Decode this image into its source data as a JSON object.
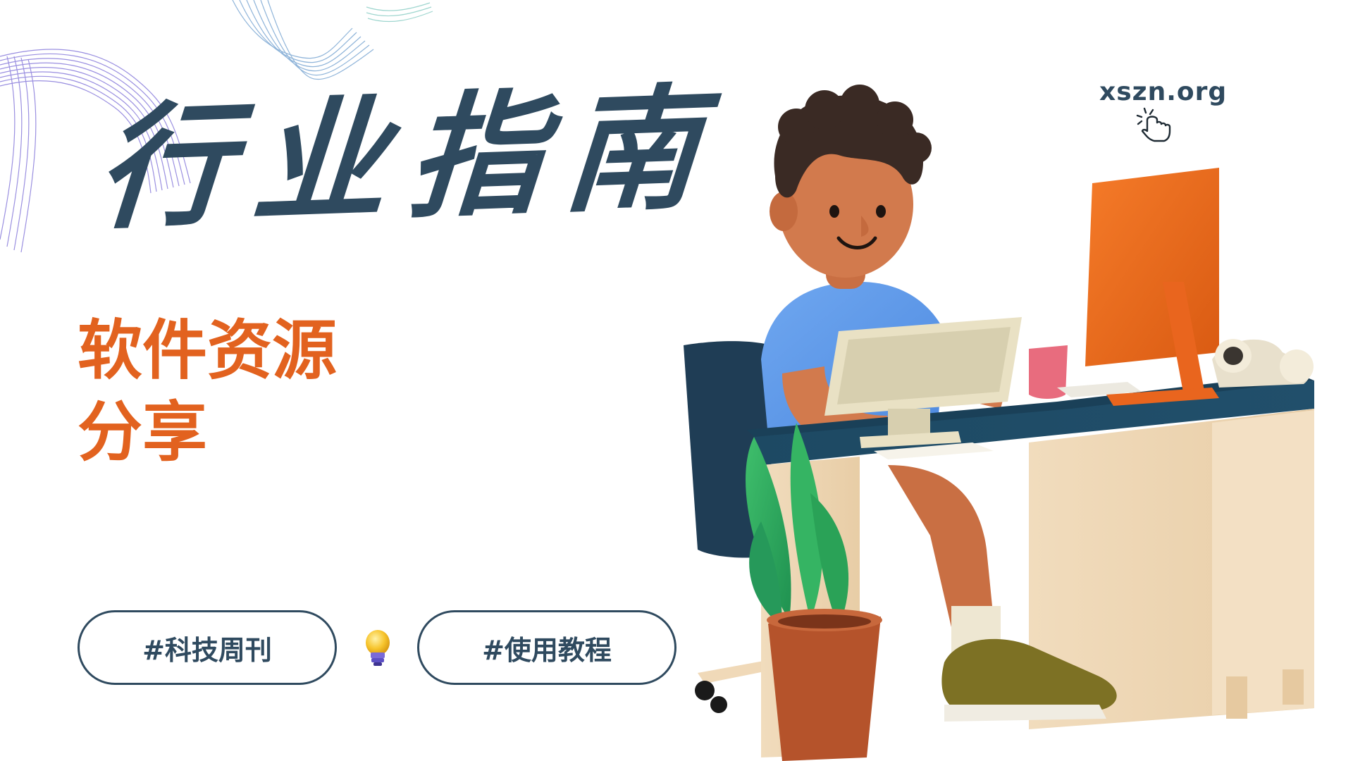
{
  "title": "行业指南",
  "subtitle": {
    "line1": "软件资源",
    "line2": "分享"
  },
  "tags": [
    {
      "label": "#科技周刊"
    },
    {
      "label": "#使用教程"
    }
  ],
  "site": {
    "url": "xszn.org"
  },
  "icons": {
    "bulb": "lightbulb-icon",
    "cursor": "hand-cursor-icon"
  },
  "colors": {
    "title": "#2f4a5f",
    "accent": "#e2621f",
    "pill_border": "#2f4a5f"
  }
}
